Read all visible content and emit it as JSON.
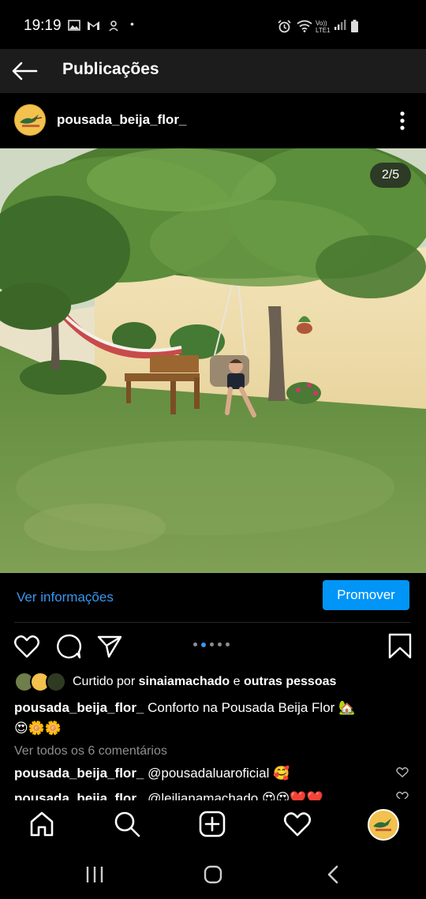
{
  "status_bar": {
    "time": "19:19",
    "left_icons": [
      "image-icon",
      "gmail-icon",
      "chat-icon",
      "notification-dot-icon"
    ],
    "right_icons": [
      "alarm-icon",
      "wifi-icon",
      "volte-icon",
      "signal-icon",
      "battery-icon"
    ],
    "volte_label": "Vo)) LTE1"
  },
  "header": {
    "title": "Publicações",
    "back_icon": "arrow-left-icon"
  },
  "post": {
    "username": "pousada_beija_flor_",
    "image_counter": "2/5",
    "image_index": 2,
    "image_total": 5,
    "ver_informacoes": "Ver informações",
    "promote_label": "Promover",
    "likes": {
      "prefix": "Curtido por ",
      "user": "sinaiamachado",
      "middle": " e ",
      "others": "outras pessoas"
    },
    "caption": {
      "user": "pousada_beija_flor_",
      "text": " Conforto na Pousada Beija Flor 🏡",
      "emojis": "😍🌼🌼"
    },
    "view_comments": "Ver todos os 6 comentários",
    "comments": [
      {
        "user": "pousada_beija_flor_",
        "text": " @pousadaluaroficial 🥰"
      },
      {
        "user": "pousada_beija_flor_",
        "text": " @leilianamachado 😍😍❤️❤️"
      }
    ]
  },
  "bottom_nav": [
    "home-icon",
    "search-icon",
    "add-post-icon",
    "activity-heart-icon",
    "profile-avatar"
  ],
  "colors": {
    "accent": "#0095f6",
    "link": "#3897f0",
    "background": "#000000",
    "header_bg": "#1c1c1c",
    "muted_text": "#8e8e8e"
  }
}
